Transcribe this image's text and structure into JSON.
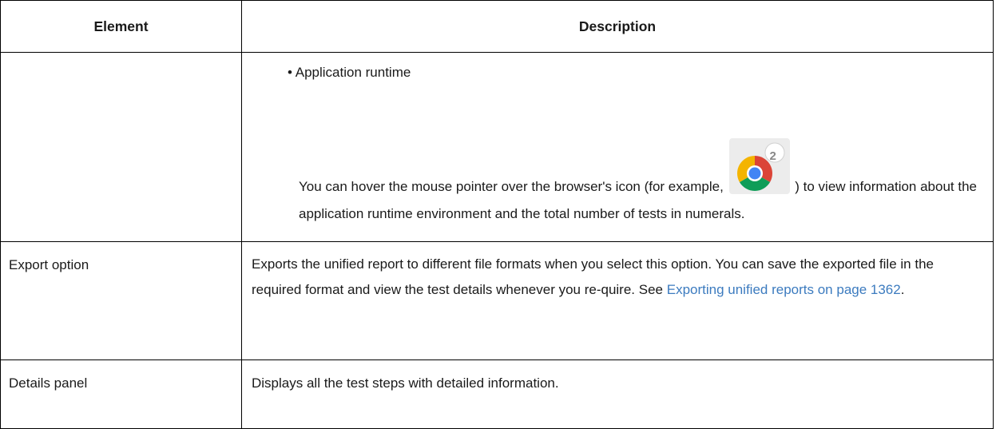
{
  "table": {
    "headers": [
      "Element",
      "Description"
    ],
    "rows": [
      {
        "element": "",
        "bullet": "• Application runtime",
        "hover_text_before": "You can hover the mouse pointer over the browser's icon (for example,",
        "hover_icon": "chrome-browser-icon",
        "hover_icon_badge": "2",
        "hover_text_after": ") to view information about the application runtime environment and the total number of tests in numerals."
      },
      {
        "element": "Export option",
        "description_before": "Exports the unified report to different file formats when you select this option. You can save the exported file in the required format and view the test details whenever you re-quire. See",
        "link": "Exporting unified reports on page 1362",
        "description_after": "."
      },
      {
        "element": "Details panel",
        "description": "Displays all the test steps with detailed information."
      }
    ]
  },
  "colors": {
    "link": "#3c7bbf",
    "border": "#000000",
    "text": "#1a1a1a"
  }
}
